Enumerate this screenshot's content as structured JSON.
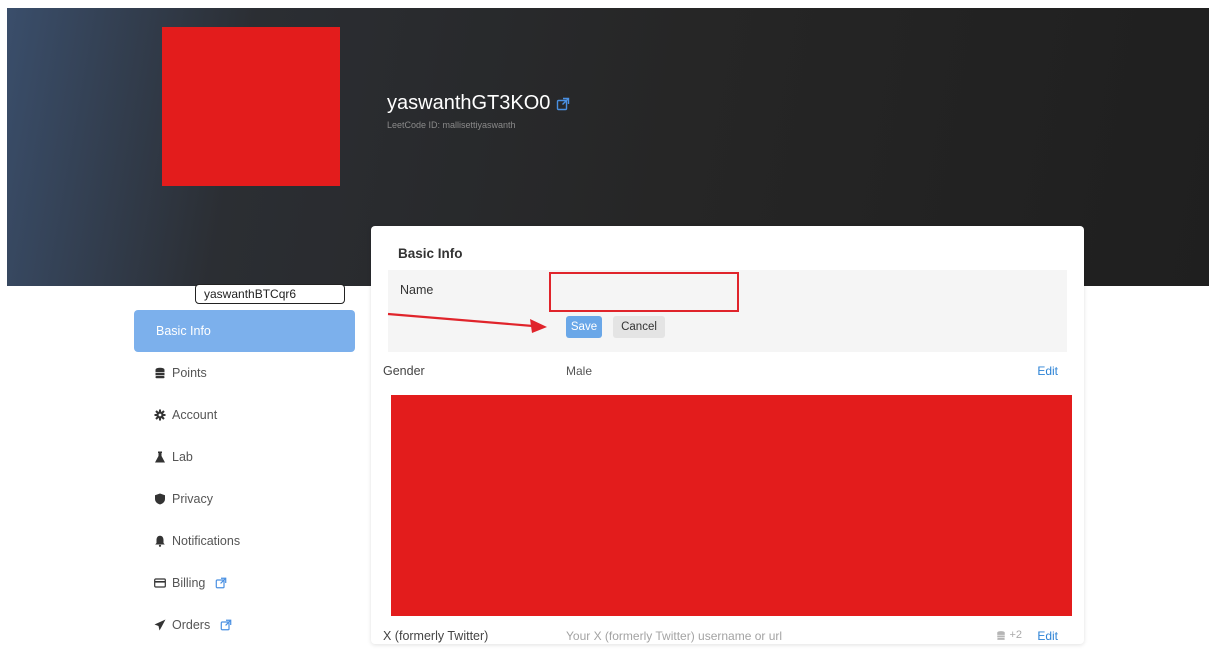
{
  "header": {
    "username": "yaswanthGT3KO0",
    "leetcode_id": "LeetCode ID: mallisettiyaswanth"
  },
  "sidebar": {
    "items": [
      {
        "label": "Basic Info",
        "icon": "none",
        "active": true
      },
      {
        "label": "Points",
        "icon": "coins-icon"
      },
      {
        "label": "Account",
        "icon": "gear-icon"
      },
      {
        "label": "Lab",
        "icon": "flask-icon"
      },
      {
        "label": "Privacy",
        "icon": "shield-icon"
      },
      {
        "label": "Notifications",
        "icon": "bell-icon"
      },
      {
        "label": "Billing",
        "icon": "credit-card-icon",
        "external": true
      },
      {
        "label": "Orders",
        "icon": "paper-plane-icon",
        "external": true
      }
    ]
  },
  "card": {
    "title": "Basic Info",
    "name_row": {
      "label": "Name",
      "input_value": "yaswanthBTCqr6",
      "save_label": "Save",
      "cancel_label": "Cancel"
    },
    "gender": {
      "label": "Gender",
      "value": "Male",
      "edit_label": "Edit"
    },
    "twitter": {
      "label": "X (formerly Twitter)",
      "placeholder": "Your X (formerly Twitter) username or url",
      "extra": "+2",
      "edit_label": "Edit"
    }
  },
  "colors": {
    "accent": "#7cb0ec",
    "save_button": "#6aa7e8",
    "link": "#2d83d6",
    "redaction": "#e31c1c",
    "annotation": "#e0242b"
  }
}
